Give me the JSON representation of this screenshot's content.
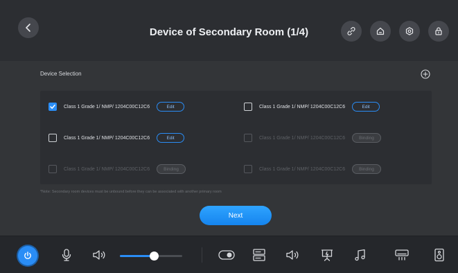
{
  "header": {
    "title": "Device of Secondary Room (1/4)",
    "back_icon": "chevron-left-icon",
    "actions": [
      "link-icon",
      "home-icon",
      "gear-icon",
      "lock-icon"
    ]
  },
  "selection": {
    "label": "Device Selection",
    "add_icon": "plus-circle-icon",
    "items": [
      {
        "label": "Class 1 Grade 1/ NMP/ 1204C00C12C6",
        "checked": true,
        "disabled": false,
        "action": "Edit"
      },
      {
        "label": "Class 1 Grade 1/ NMP/ 1204C00C12C6",
        "checked": false,
        "disabled": false,
        "action": "Edit"
      },
      {
        "label": "Class 1 Grade 1/ NMP/ 1204C00C12C6",
        "checked": false,
        "disabled": false,
        "action": "Edit"
      },
      {
        "label": "Class 1 Grade 1/ NMP/ 1204C00C12C6",
        "checked": false,
        "disabled": true,
        "action": "Binding"
      },
      {
        "label": "Class 1 Grade 1/ NMP/ 1204C00C12C6",
        "checked": false,
        "disabled": true,
        "action": "Binding"
      },
      {
        "label": "Class 1 Grade 1/ NMP/ 1204C00C12C6",
        "checked": false,
        "disabled": true,
        "action": "Binding"
      }
    ],
    "note": "*Note: Secondary room devices must be unbound before they can be associated with another primary room",
    "next_label": "Next"
  },
  "bottom_bar": {
    "volume_fraction": 0.55,
    "icons": [
      "power-icon",
      "microphone-icon",
      "speaker-icon",
      "toggle-icon",
      "device-rack-icon",
      "speaker-icon",
      "projector-icon",
      "music-note-icon",
      "air-conditioner-icon",
      "speaker-box-icon"
    ]
  },
  "colors": {
    "accent": "#2a8df6",
    "background": "#333538",
    "header": "#2c2e32"
  }
}
